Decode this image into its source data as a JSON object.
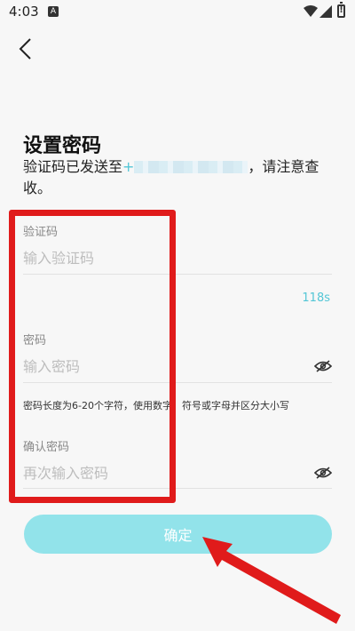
{
  "status_bar": {
    "time": "4:03",
    "notification_icon": "a-icon"
  },
  "header": {
    "back_icon": "chevron-left-icon"
  },
  "page": {
    "title": "设置密码",
    "subtitle_prefix": "验证码已发送至",
    "phone_prefix": "+",
    "subtitle_suffix": "，请注意查收。"
  },
  "form": {
    "code_label": "验证码",
    "code_placeholder": "输入验证码",
    "countdown": "118s",
    "password_label": "密码",
    "password_placeholder": "输入密码",
    "password_hint": "密码长度为6-20个字符，使用数字、符号或字母并区分大小写",
    "confirm_label": "确认密码",
    "confirm_placeholder": "再次输入密码",
    "submit_label": "确定"
  },
  "colors": {
    "accent": "#53c6d6",
    "button": "#92e3ea",
    "annotation": "#e01b1b"
  }
}
